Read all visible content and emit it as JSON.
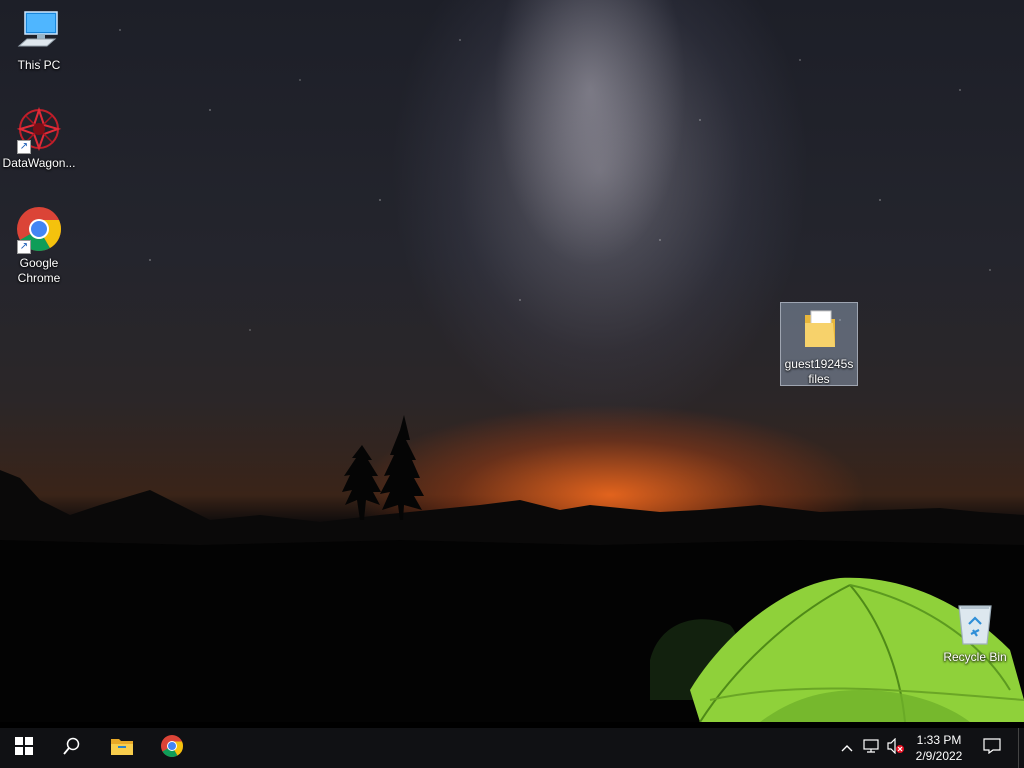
{
  "desktop": {
    "icons": [
      {
        "label": "This PC"
      },
      {
        "label": "DataWagon..."
      },
      {
        "label": "Google Chrome"
      },
      {
        "label": "guest19245s files"
      },
      {
        "label": "Recycle Bin"
      }
    ]
  },
  "taskbar": {
    "start": {
      "icon": "windows-logo-icon"
    },
    "search": {
      "icon": "search-icon"
    },
    "pinned": [
      {
        "icon": "file-explorer-icon"
      },
      {
        "icon": "chrome-icon"
      }
    ],
    "tray": {
      "chevron_icon": "chevron-up-icon",
      "network_icon": "network-icon",
      "volume_icon": "volume-muted-icon",
      "time": "1:33 PM",
      "date": "2/9/2022",
      "notification_icon": "action-center-icon"
    }
  },
  "colors": {
    "taskbar": "#101114",
    "tent_green": "#8fd13a",
    "horizon_glow": "#ff6e1e"
  }
}
